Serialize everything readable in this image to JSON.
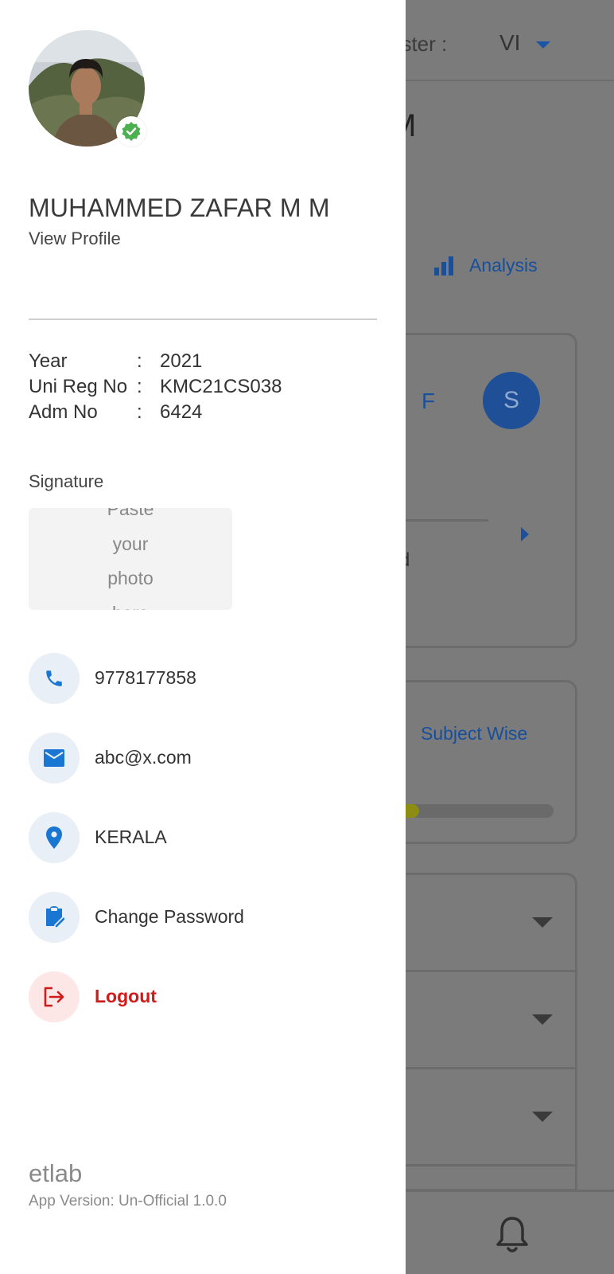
{
  "background": {
    "semester_label": "ester :",
    "semester_value": "VI",
    "title_fragment": "M",
    "analysis_label": "Analysis",
    "card_letter_f": "F",
    "card_letter_s": "S",
    "card_text_fragment": "d",
    "subject_wise_label": "Subject Wise",
    "progress_fraction": 0.14
  },
  "profile": {
    "name": "MUHAMMED ZAFAR M M",
    "view_profile_label": "View Profile",
    "details": [
      {
        "key": "Year",
        "colon": ":",
        "value": "2021"
      },
      {
        "key": "Uni Reg No",
        "colon": ":",
        "value": "KMC21CS038"
      },
      {
        "key": "Adm No",
        "colon": ":",
        "value": "6424"
      }
    ],
    "signature_label": "Signature",
    "signature_placeholder_lines": [
      "Paste",
      "your",
      "photo",
      "here"
    ]
  },
  "menu": [
    {
      "label": "9778177858",
      "icon": "phone-icon"
    },
    {
      "label": "abc@x.com",
      "icon": "mail-icon"
    },
    {
      "label": "KERALA",
      "icon": "location-icon"
    },
    {
      "label": "Change Password",
      "icon": "clipboard-edit-icon"
    },
    {
      "label": "Logout",
      "icon": "logout-icon"
    }
  ],
  "footer": {
    "app_name": "etlab",
    "app_version": "App Version: Un-Official 1.0.0"
  },
  "colors": {
    "accent": "#1976d2",
    "logout": "#d11a1a",
    "verified": "#4caf50",
    "overlay": "#7b7b7b"
  }
}
